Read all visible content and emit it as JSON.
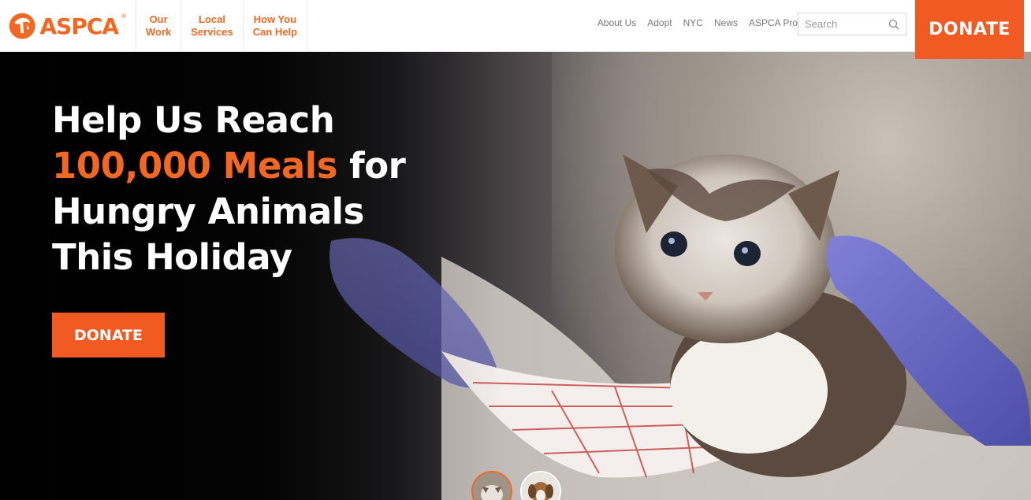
{
  "header": {
    "logo_text": "ASPCA",
    "logo_tm": "®",
    "main_nav": [
      {
        "label": "Our\nWork"
      },
      {
        "label": "Local\nServices"
      },
      {
        "label": "How You\nCan Help"
      }
    ],
    "util_nav": [
      "About Us",
      "Adopt",
      "NYC",
      "News",
      "ASPCA Pro"
    ],
    "search": {
      "placeholder": "Search",
      "icon": "search-icon"
    },
    "donate_label": "DONATE"
  },
  "hero": {
    "headline": {
      "line1": "Help Us Reach",
      "highlight": "100,000 Meals",
      "line2_rest": " for",
      "line3": "Hungry Animals",
      "line4": "This Holiday"
    },
    "donate_label": "DONATE",
    "slides": [
      {
        "name": "kitten-slide-thumb",
        "active": true
      },
      {
        "name": "dog-slide-thumb",
        "active": false
      }
    ]
  },
  "colors": {
    "brand_orange": "#f26722",
    "donate_orange": "#f15a22",
    "hero_text": "#ffffff"
  }
}
